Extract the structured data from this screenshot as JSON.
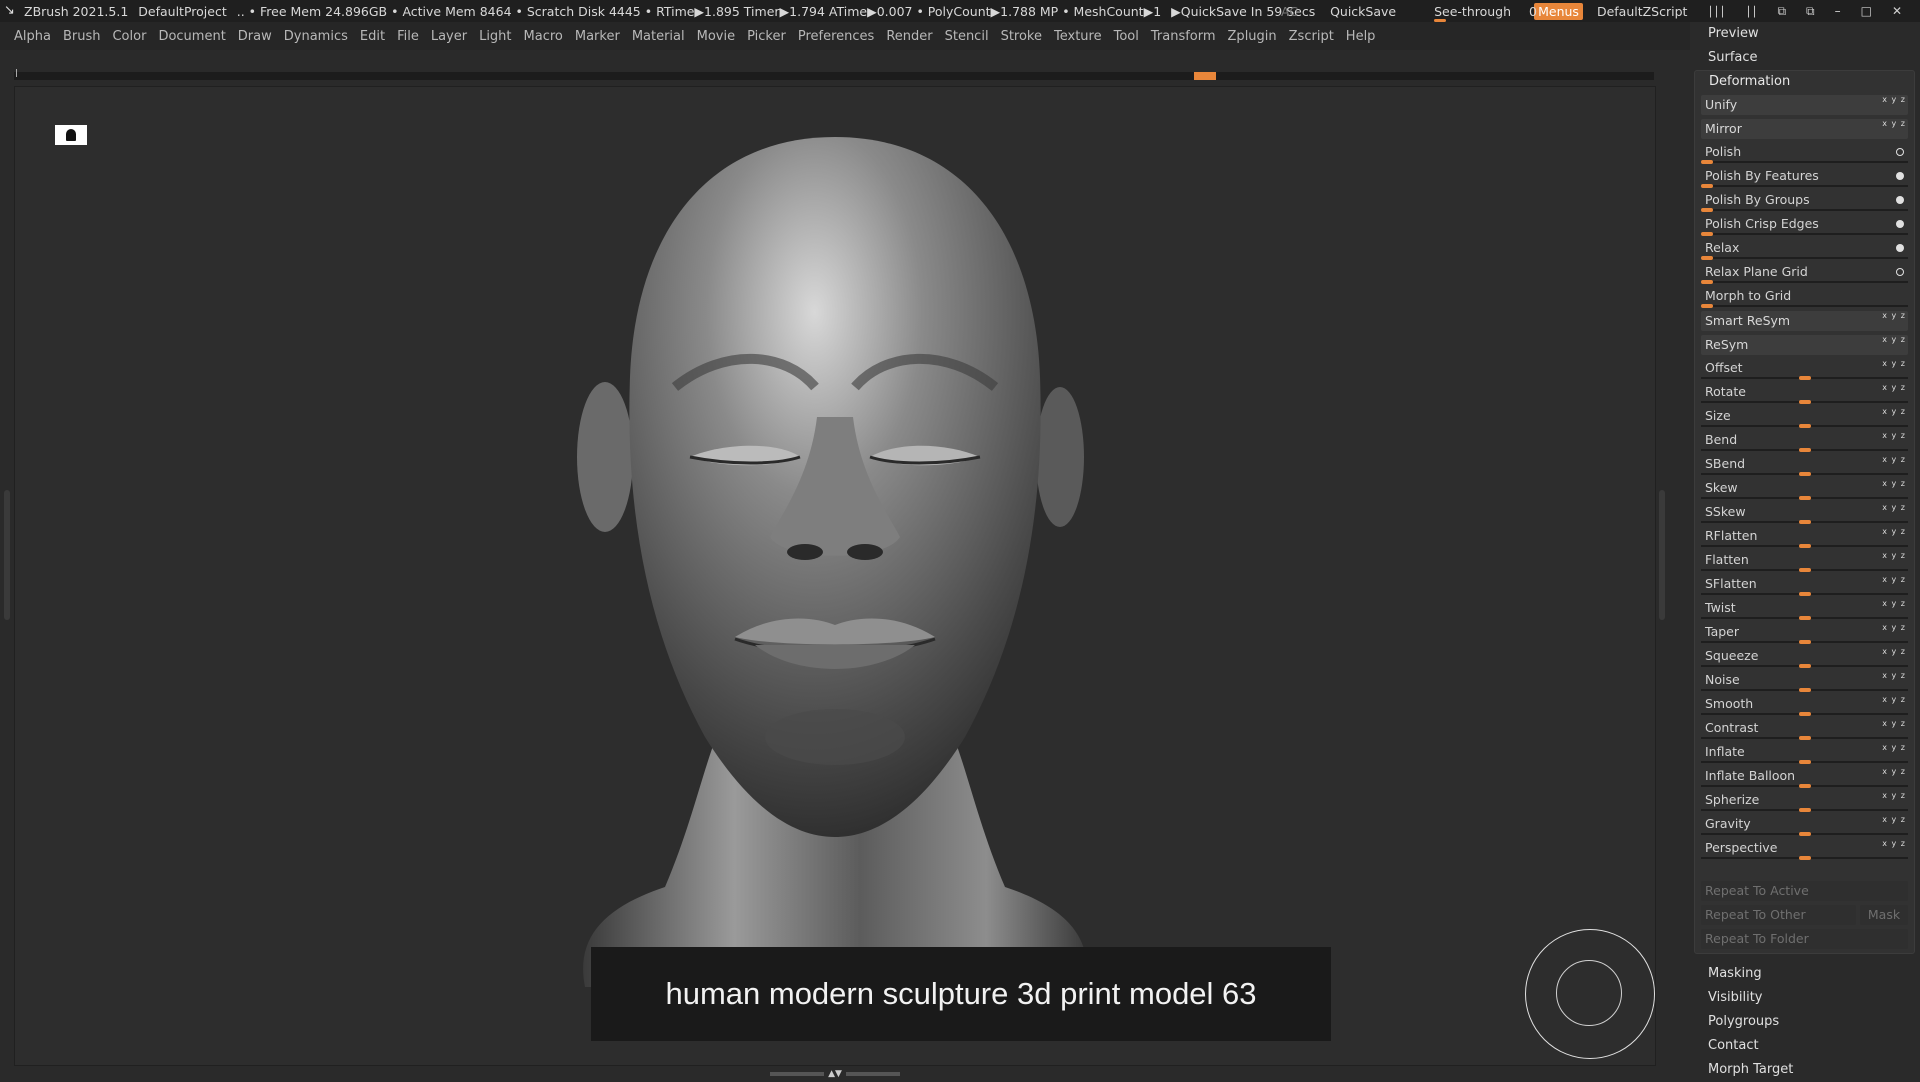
{
  "titlebar": {
    "app": "ZBrush 2021.5.1",
    "project": "DefaultProject",
    "stats": ".. • Free Mem 24.896GB • Active Mem 8464 • Scratch Disk 4445 •  RTime▶1.895 Timer▶1.794 ATime▶0.007 • PolyCount▶1.788 MP  • MeshCount▶1",
    "quicksave_timer": "▶QuickSave In 59 Secs",
    "ac": "AC",
    "quicksave": "QuickSave",
    "see_through_label": "See-through",
    "see_through_value": "0",
    "menus": "Menus",
    "zscript": "DefaultZScript"
  },
  "menubar": [
    "Alpha",
    "Brush",
    "Color",
    "Document",
    "Draw",
    "Dynamics",
    "Edit",
    "File",
    "Layer",
    "Light",
    "Macro",
    "Marker",
    "Material",
    "Movie",
    "Picker",
    "Preferences",
    "Render",
    "Stencil",
    "Stroke",
    "Texture",
    "Tool",
    "Transform",
    "Zplugin",
    "Zscript",
    "Help"
  ],
  "viewport": {
    "caption": "human modern sculpture 3d print model 63"
  },
  "palette": {
    "preview": "Preview",
    "surface": "Surface",
    "deformation": "Deformation",
    "buttons": {
      "unify": "Unify",
      "mirror": "Mirror",
      "smart_resym": "Smart ReSym",
      "resym": "ReSym"
    },
    "dot_rows": [
      "Polish",
      "Polish By Features",
      "Polish By Groups",
      "Polish Crisp Edges",
      "Relax",
      "Relax Plane Grid",
      "Morph to Grid"
    ],
    "slider_rows": [
      "Offset",
      "Rotate",
      "Size",
      "Bend",
      "SBend",
      "Skew",
      "SSkew",
      "RFlatten",
      "Flatten",
      "SFlatten",
      "Twist",
      "Taper",
      "Squeeze",
      "Noise",
      "Smooth",
      "Contrast",
      "Inflate",
      "Inflate Balloon",
      "Spherize",
      "Gravity",
      "Perspective"
    ],
    "repeat_active": "Repeat To Active",
    "repeat_other": "Repeat To Other",
    "mask": "Mask",
    "repeat_folder": "Repeat To Folder",
    "sections_after": [
      "Masking",
      "Visibility",
      "Polygroups",
      "Contact",
      "Morph Target"
    ]
  },
  "colors": {
    "accent": "#e8863a",
    "background": "#2a2a2a"
  }
}
